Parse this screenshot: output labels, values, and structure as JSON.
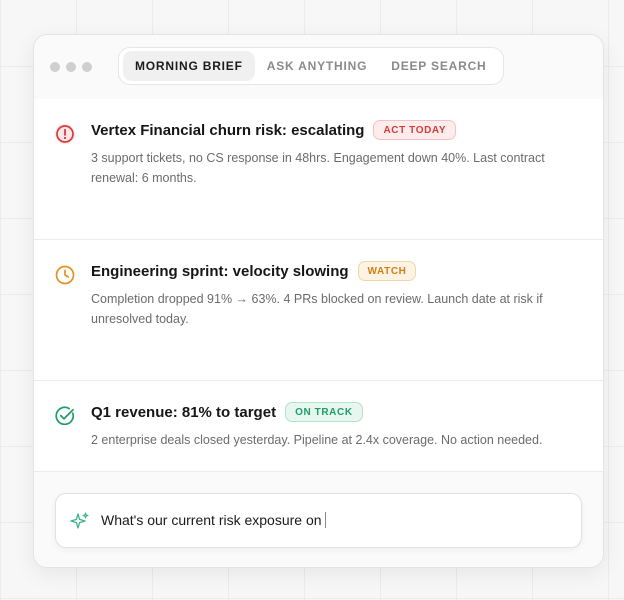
{
  "tabs": [
    {
      "label": "MORNING BRIEF",
      "active": true
    },
    {
      "label": "ASK ANYTHING",
      "active": false
    },
    {
      "label": "DEEP SEARCH",
      "active": false
    }
  ],
  "cards": [
    {
      "icon": "alert-circle-icon",
      "title": "Vertex Financial churn risk: escalating",
      "badge": "ACT TODAY",
      "badge_color": "#d93b3b",
      "desc": "3 support tickets, no CS response in 48hrs. Engagement down 40%. Last contract renewal: 6 months."
    },
    {
      "icon": "clock-icon",
      "title": "Engineering sprint: velocity slowing",
      "badge": "WATCH",
      "badge_color": "#d98a1e",
      "desc": "Completion dropped 91% → 63%. 4 PRs blocked on review. Launch date at risk if unresolved today."
    },
    {
      "icon": "check-circle-icon",
      "title": "Q1 revenue: 81% to target",
      "badge": "ON TRACK",
      "badge_color": "#1f9e6a",
      "desc": "2 enterprise deals closed yesterday. Pipeline at 2.4x coverage. No action needed."
    }
  ],
  "input": {
    "icon": "sparkle-icon",
    "value": "What's our current risk exposure on"
  }
}
